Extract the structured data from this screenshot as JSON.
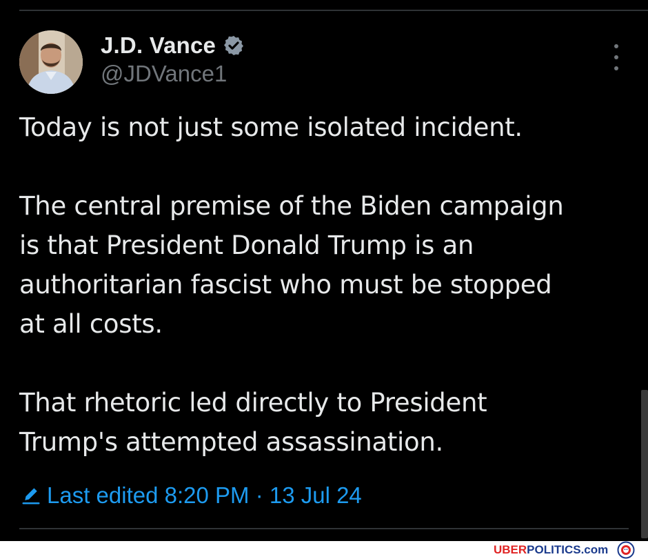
{
  "tweet": {
    "author": {
      "display_name": "J.D. Vance",
      "handle": "@JDVance1",
      "verified": true,
      "verified_color": "#1d9bf0"
    },
    "body": {
      "paragraph_1": "Today is not just some isolated incident.",
      "paragraph_2_lines": [
        "The central premise of the Biden campaign",
        "is that President Donald Trump is an",
        "authoritarian fascist who must be stopped",
        "at all costs."
      ],
      "paragraph_3_lines": [
        "That rhetoric led directly to President",
        "Trump's attempted assassination."
      ]
    },
    "edited": {
      "label": "Last edited 8:20 PM · 13 Jul 24",
      "color": "#1d9bf0"
    },
    "icons": {
      "more": "more-vertical-icon",
      "edit": "pencil-icon",
      "verified": "verified-badge-icon"
    }
  },
  "watermark": {
    "part_1": "UBER",
    "part_2": "POLITICS",
    "part_3": ".com"
  },
  "colors": {
    "background": "#000000",
    "text": "#e7e9ea",
    "secondary_text": "#71767b",
    "accent": "#1d9bf0",
    "divider": "#2f3336"
  }
}
